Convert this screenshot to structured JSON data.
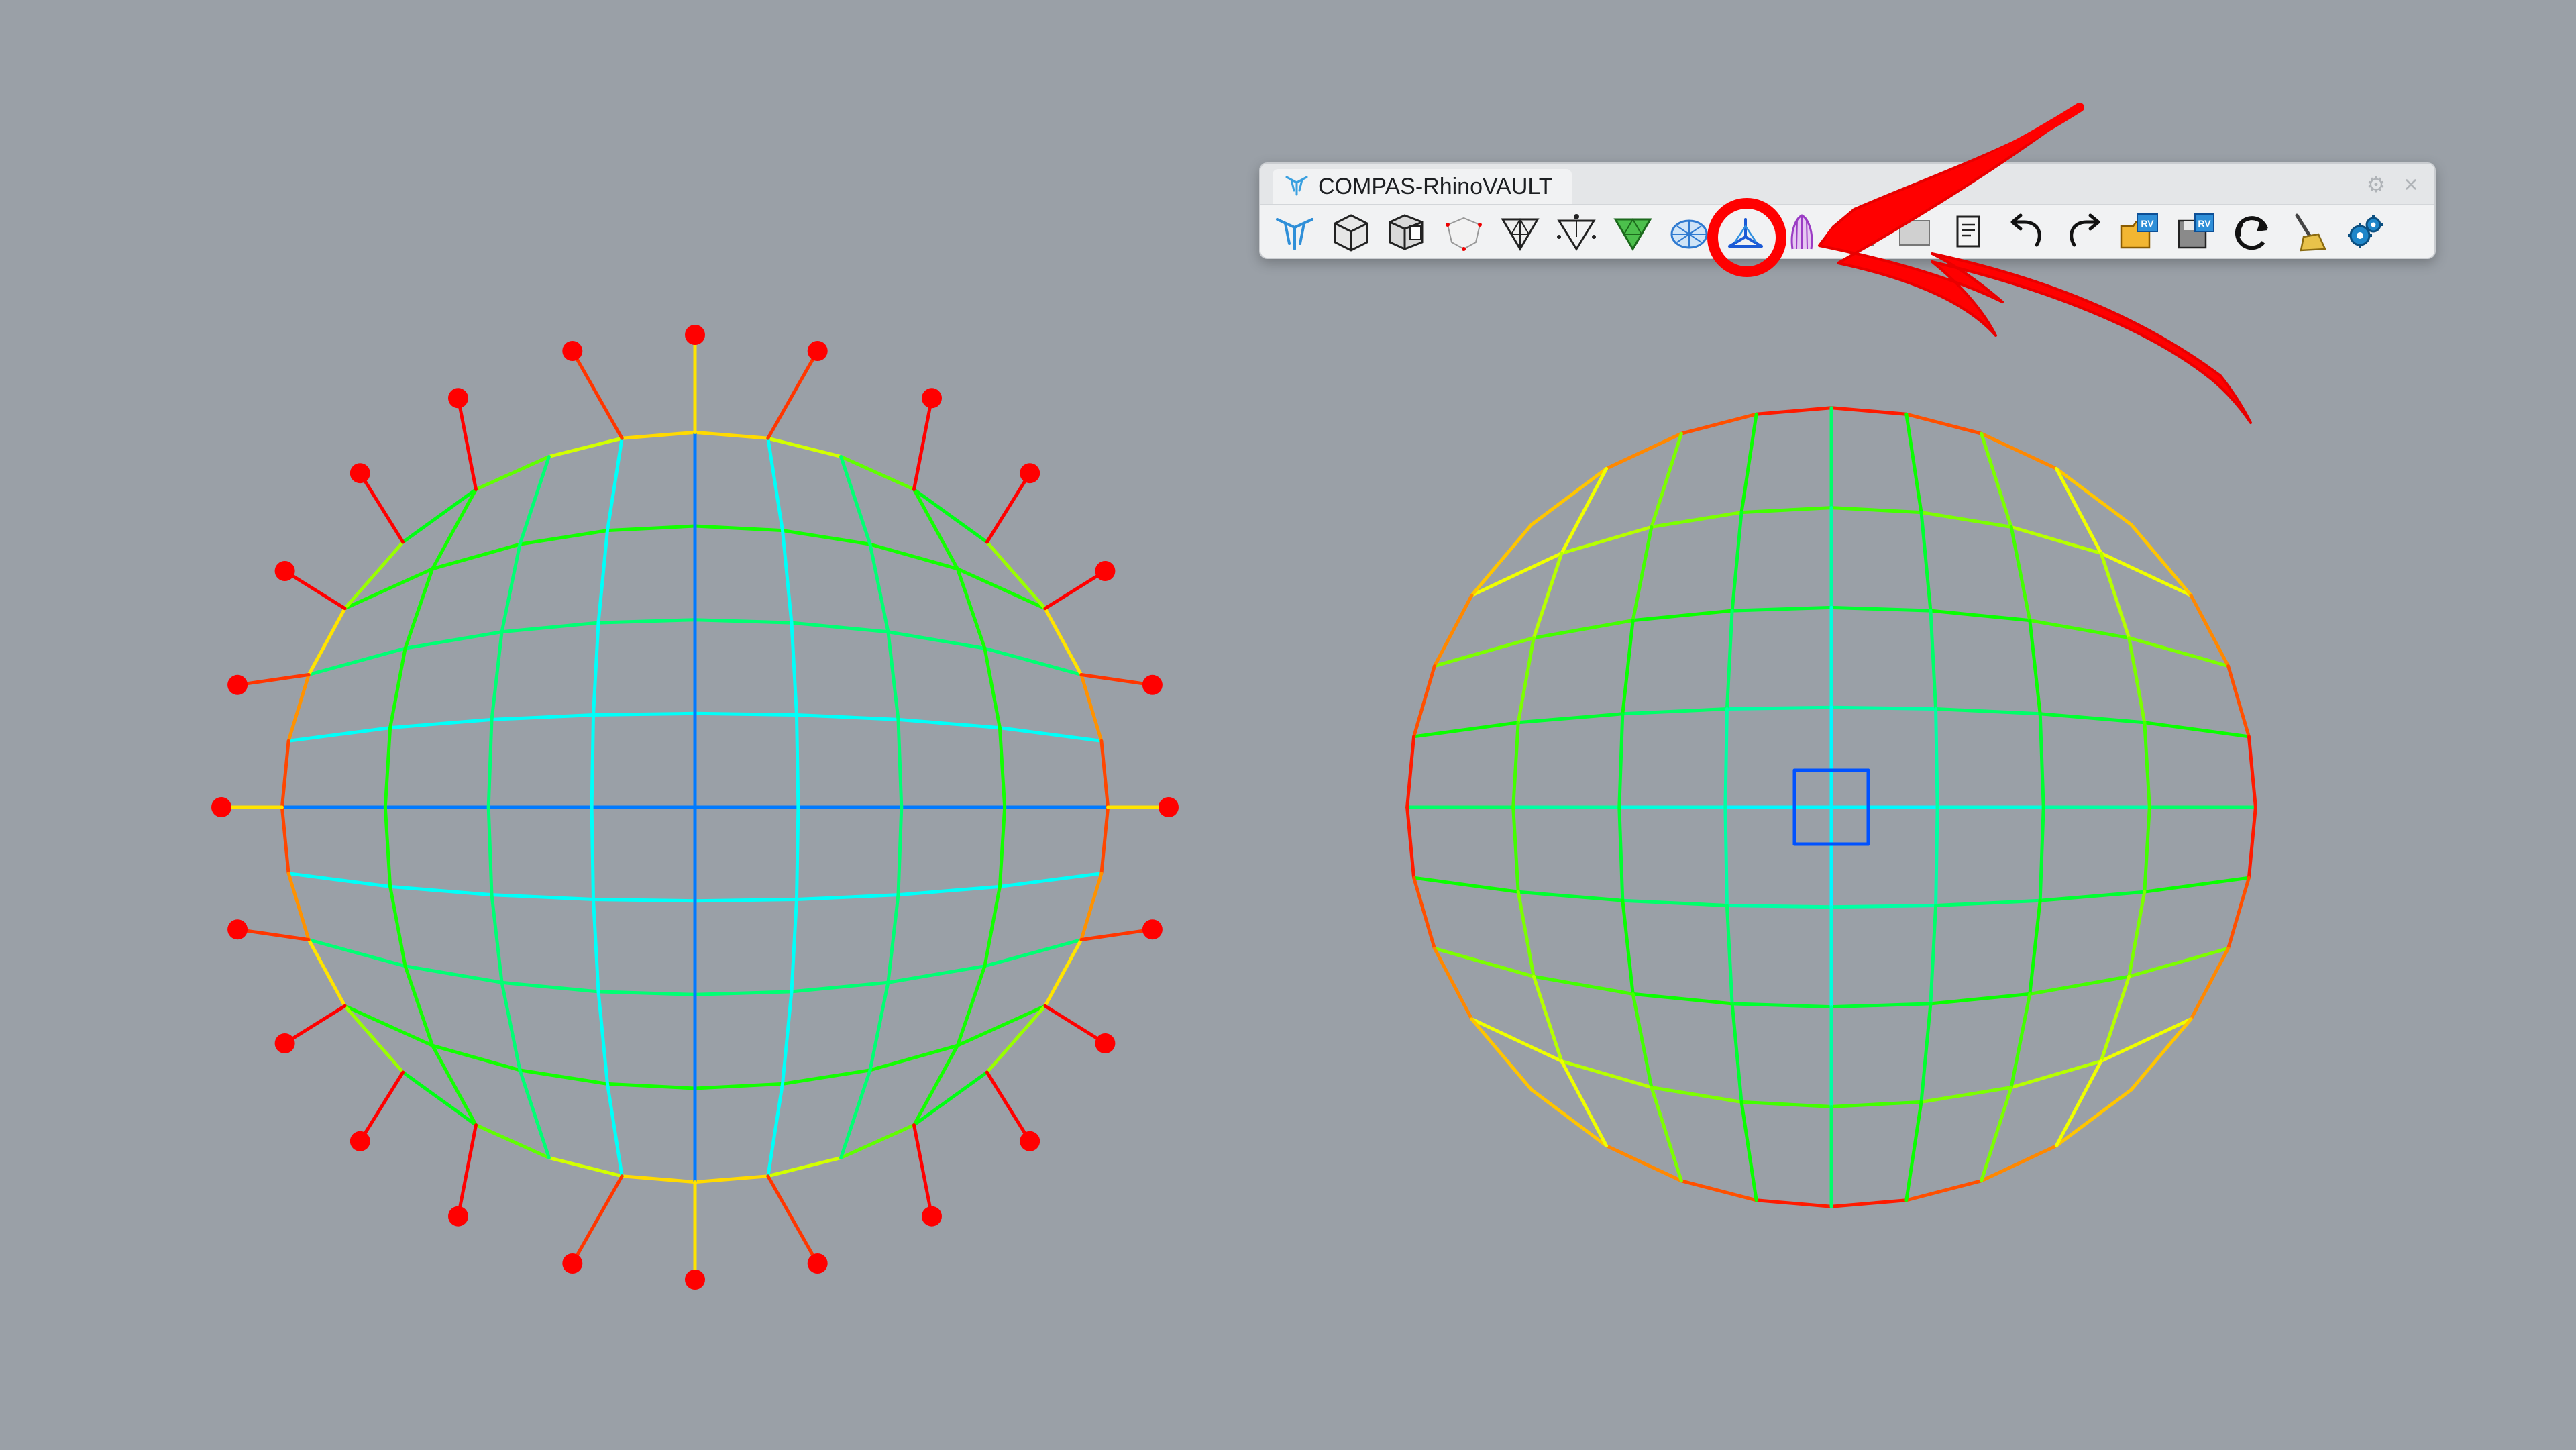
{
  "panel": {
    "title": "COMPAS-RhinoVAULT",
    "title_icon": "rhinovault-logo-icon",
    "settings_icon": "gear-icon",
    "close_icon": "close-icon",
    "close_glyph": "×",
    "settings_glyph": "⚙"
  },
  "toolbar": {
    "tools": [
      {
        "name": "rhinovault-init-button",
        "icon": "rhinovault-logo-icon"
      },
      {
        "name": "form-diagram-button",
        "icon": "box-icon"
      },
      {
        "name": "form-from-file-button",
        "icon": "box-stack-icon"
      },
      {
        "name": "form-from-surface-button",
        "icon": "dotted-dome-icon"
      },
      {
        "name": "form-diagram-modify-button",
        "icon": "triangle-mesh-icon"
      },
      {
        "name": "form-supports-button",
        "icon": "supports-icon"
      },
      {
        "name": "force-diagram-button",
        "icon": "green-triangle-icon"
      },
      {
        "name": "horizontal-equilibrium-button",
        "icon": "mesh-dome-icon"
      },
      {
        "name": "vertical-equilibrium-button",
        "icon": "tripod-icon",
        "highlighted": true
      },
      {
        "name": "thrust-diagram-button",
        "icon": "purple-vault-icon"
      },
      {
        "name": "hidden-tool-1-button",
        "icon": "hidden-icon"
      },
      {
        "name": "hidden-tool-2-button",
        "icon": "hidden-icon"
      },
      {
        "name": "report-button",
        "icon": "report-icon"
      },
      {
        "name": "undo-button",
        "icon": "undo-icon"
      },
      {
        "name": "redo-button",
        "icon": "redo-icon"
      },
      {
        "name": "open-session-button",
        "icon": "folder-rv-icon"
      },
      {
        "name": "save-session-button",
        "icon": "save-rv-icon"
      },
      {
        "name": "refresh-button",
        "icon": "refresh-icon"
      },
      {
        "name": "clear-button",
        "icon": "broom-icon"
      },
      {
        "name": "settings-button",
        "icon": "gears-icon"
      }
    ]
  },
  "colors": {
    "background": "#9aa0a7",
    "support_point": "#ff0000",
    "annotation": "#ff0000",
    "force_scale": [
      "#0000ff",
      "#00aaff",
      "#00ffff",
      "#00ff00",
      "#ffff00",
      "#ff7700",
      "#ff0000"
    ]
  },
  "diagrams": {
    "form_diagram": {
      "label": "form-diagram",
      "support_count": 24
    },
    "force_diagram": {
      "label": "force-diagram"
    }
  },
  "annotation": {
    "target": "vertical-equilibrium-button",
    "type": "red-circle-and-arrow"
  }
}
